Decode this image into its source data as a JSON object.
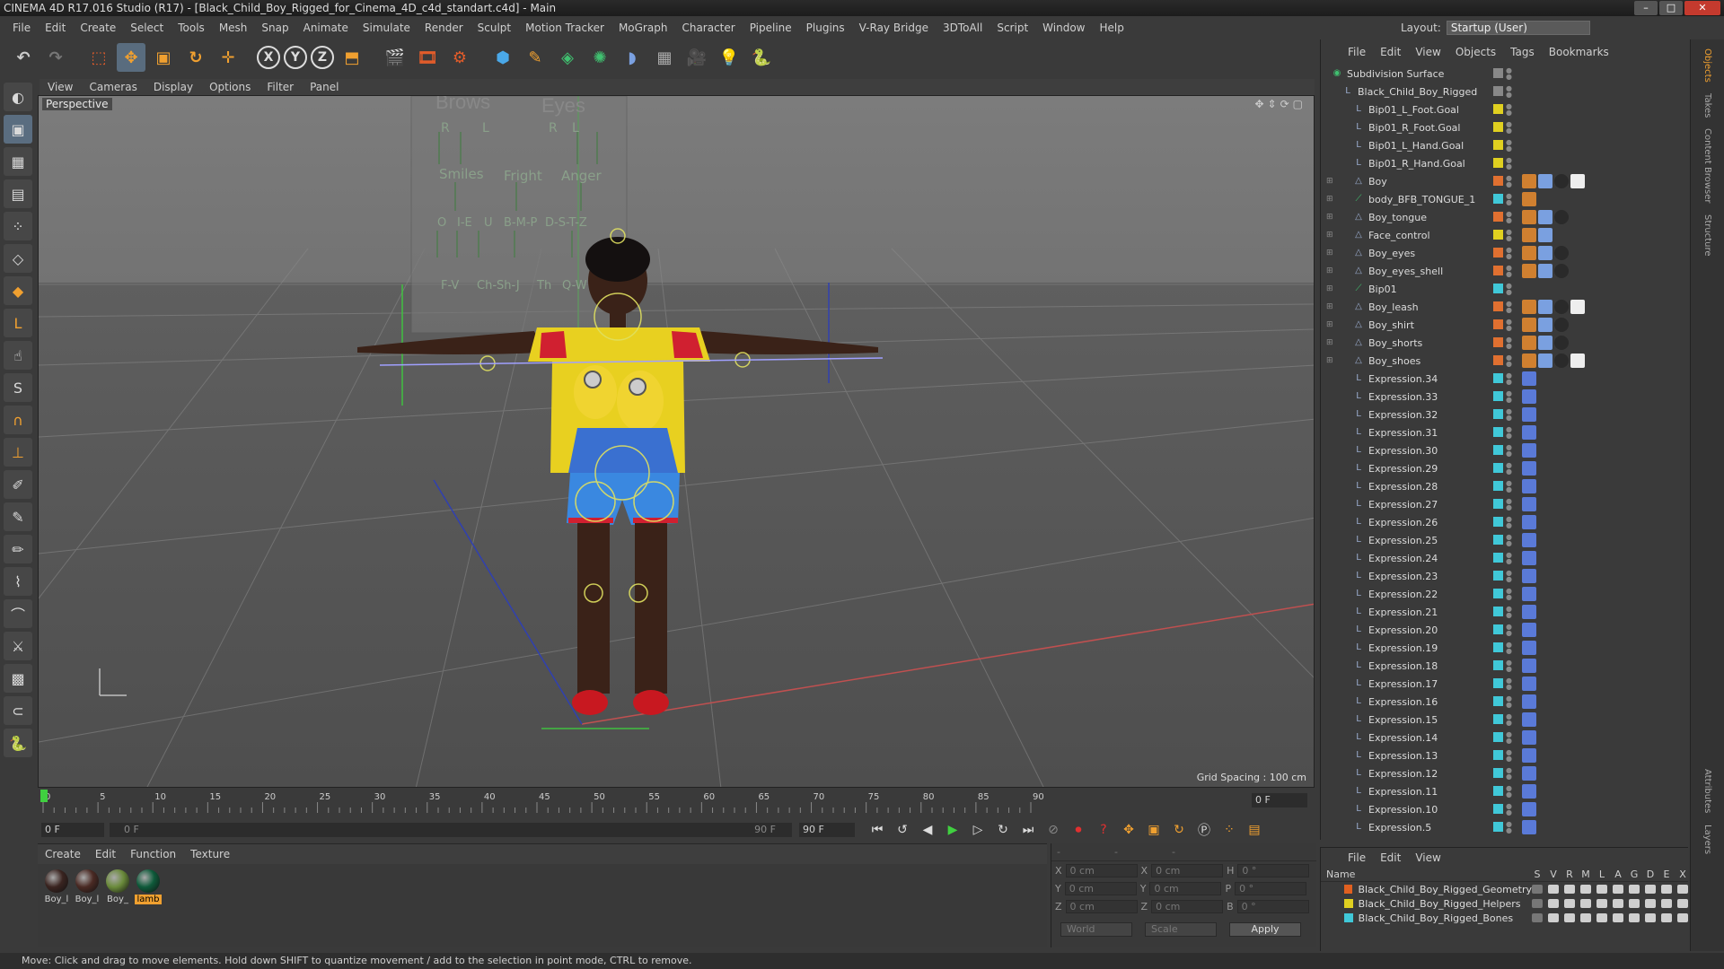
{
  "window": {
    "title": "CINEMA 4D R17.016 Studio (R17) - [Black_Child_Boy_Rigged_for_Cinema_4D_c4d_standart.c4d] - Main"
  },
  "menu": [
    "File",
    "Edit",
    "Create",
    "Select",
    "Tools",
    "Mesh",
    "Snap",
    "Animate",
    "Simulate",
    "Render",
    "Sculpt",
    "Motion Tracker",
    "MoGraph",
    "Character",
    "Pipeline",
    "Plugins",
    "V-Ray Bridge",
    "3DToAll",
    "Script",
    "Window",
    "Help"
  ],
  "layout": {
    "label": "Layout:",
    "value": "Startup (User)"
  },
  "viewport": {
    "menu": [
      "View",
      "Cameras",
      "Display",
      "Options",
      "Filter",
      "Panel"
    ],
    "label": "Perspective",
    "grid_spacing": "Grid Spacing : 100 cm",
    "face_panel": {
      "brows": "Brows",
      "eyes": "Eyes",
      "r1": "R",
      "l1": "L",
      "r2": "R",
      "l2": "L",
      "smiles": "Smiles",
      "fright": "Fright",
      "anger": "Anger",
      "o": "O",
      "ie": "I-E",
      "u": "U",
      "bmp": "B-M-P",
      "dstz": "D-S-T-Z",
      "fv": "F-V",
      "chshj": "Ch-Sh-J",
      "th": "Th",
      "qw": "Q-W"
    }
  },
  "timeline": {
    "ticks": [
      "0",
      "5",
      "10",
      "15",
      "20",
      "25",
      "30",
      "35",
      "40",
      "45",
      "50",
      "55",
      "60",
      "65",
      "70",
      "75",
      "80",
      "85",
      "90"
    ],
    "current_frame": "0 F",
    "start": "0 F",
    "range_start": "0 F",
    "range_end": "90 F",
    "end": "90 F"
  },
  "materials": {
    "menu": [
      "Create",
      "Edit",
      "Function",
      "Texture"
    ],
    "items": [
      {
        "label": "Boy_l",
        "color": "#3a2420"
      },
      {
        "label": "Boy_l",
        "color": "#4a2a24"
      },
      {
        "label": "Boy_",
        "color": "#6a8a3a"
      },
      {
        "label": "lamb",
        "color": "#0e5a3a"
      }
    ]
  },
  "coords": {
    "x1": "X",
    "x1v": "0 cm",
    "x2": "X",
    "x2v": "0 cm",
    "h": "H",
    "hv": "0 °",
    "y1": "Y",
    "y1v": "0 cm",
    "y2": "Y",
    "y2v": "0 cm",
    "p": "P",
    "pv": "0 °",
    "z1": "Z",
    "z1v": "0 cm",
    "z2": "Z",
    "z2v": "0 cm",
    "b": "B",
    "bv": "0 °",
    "world": "World",
    "scale": "Scale",
    "apply": "Apply"
  },
  "object_manager": {
    "menu": [
      "File",
      "Edit",
      "View",
      "Objects",
      "Tags",
      "Bookmarks"
    ],
    "objects": [
      {
        "name": "Subdivision Surface",
        "indent": 0,
        "color": "#888888"
      },
      {
        "name": "Black_Child_Boy_Rigged",
        "indent": 1,
        "color": "#888888"
      },
      {
        "name": "Bip01_L_Foot.Goal",
        "indent": 2,
        "color": "#e0d020"
      },
      {
        "name": "Bip01_R_Foot.Goal",
        "indent": 2,
        "color": "#e0d020"
      },
      {
        "name": "Bip01_L_Hand.Goal",
        "indent": 2,
        "color": "#e0d020"
      },
      {
        "name": "Bip01_R_Hand.Goal",
        "indent": 2,
        "color": "#e0d020"
      },
      {
        "name": "Boy",
        "indent": 2,
        "color": "#e07030"
      },
      {
        "name": "body_BFB_TONGUE_1",
        "indent": 2,
        "color": "#40c8d8"
      },
      {
        "name": "Boy_tongue",
        "indent": 2,
        "color": "#e07030"
      },
      {
        "name": "Face_control",
        "indent": 2,
        "color": "#e0d020"
      },
      {
        "name": "Boy_eyes",
        "indent": 2,
        "color": "#e07030"
      },
      {
        "name": "Boy_eyes_shell",
        "indent": 2,
        "color": "#e07030"
      },
      {
        "name": "Bip01",
        "indent": 2,
        "color": "#40c8d8"
      },
      {
        "name": "Boy_leash",
        "indent": 2,
        "color": "#e07030"
      },
      {
        "name": "Boy_shirt",
        "indent": 2,
        "color": "#e07030"
      },
      {
        "name": "Boy_shorts",
        "indent": 2,
        "color": "#e07030"
      },
      {
        "name": "Boy_shoes",
        "indent": 2,
        "color": "#e07030"
      },
      {
        "name": "Expression.34",
        "indent": 2,
        "color": "#40c8d8"
      },
      {
        "name": "Expression.33",
        "indent": 2,
        "color": "#40c8d8"
      },
      {
        "name": "Expression.32",
        "indent": 2,
        "color": "#40c8d8"
      },
      {
        "name": "Expression.31",
        "indent": 2,
        "color": "#40c8d8"
      },
      {
        "name": "Expression.30",
        "indent": 2,
        "color": "#40c8d8"
      },
      {
        "name": "Expression.29",
        "indent": 2,
        "color": "#40c8d8"
      },
      {
        "name": "Expression.28",
        "indent": 2,
        "color": "#40c8d8"
      },
      {
        "name": "Expression.27",
        "indent": 2,
        "color": "#40c8d8"
      },
      {
        "name": "Expression.26",
        "indent": 2,
        "color": "#40c8d8"
      },
      {
        "name": "Expression.25",
        "indent": 2,
        "color": "#40c8d8"
      },
      {
        "name": "Expression.24",
        "indent": 2,
        "color": "#40c8d8"
      },
      {
        "name": "Expression.23",
        "indent": 2,
        "color": "#40c8d8"
      },
      {
        "name": "Expression.22",
        "indent": 2,
        "color": "#40c8d8"
      },
      {
        "name": "Expression.21",
        "indent": 2,
        "color": "#40c8d8"
      },
      {
        "name": "Expression.20",
        "indent": 2,
        "color": "#40c8d8"
      },
      {
        "name": "Expression.19",
        "indent": 2,
        "color": "#40c8d8"
      },
      {
        "name": "Expression.18",
        "indent": 2,
        "color": "#40c8d8"
      },
      {
        "name": "Expression.17",
        "indent": 2,
        "color": "#40c8d8"
      },
      {
        "name": "Expression.16",
        "indent": 2,
        "color": "#40c8d8"
      },
      {
        "name": "Expression.15",
        "indent": 2,
        "color": "#40c8d8"
      },
      {
        "name": "Expression.14",
        "indent": 2,
        "color": "#40c8d8"
      },
      {
        "name": "Expression.13",
        "indent": 2,
        "color": "#40c8d8"
      },
      {
        "name": "Expression.12",
        "indent": 2,
        "color": "#40c8d8"
      },
      {
        "name": "Expression.11",
        "indent": 2,
        "color": "#40c8d8"
      },
      {
        "name": "Expression.10",
        "indent": 2,
        "color": "#40c8d8"
      },
      {
        "name": "Expression.5",
        "indent": 2,
        "color": "#40c8d8"
      }
    ]
  },
  "layer_manager": {
    "menu": [
      "File",
      "Edit",
      "View"
    ],
    "name_header": "Name",
    "cols": [
      "S",
      "V",
      "R",
      "M",
      "L",
      "A",
      "G",
      "D",
      "E",
      "X"
    ],
    "layers": [
      {
        "name": "Black_Child_Boy_Rigged_Geometry",
        "color": "#e06020"
      },
      {
        "name": "Black_Child_Boy_Rigged_Helpers",
        "color": "#e0d020"
      },
      {
        "name": "Black_Child_Boy_Rigged_Bones",
        "color": "#40c8d8"
      }
    ]
  },
  "right_tabs": [
    "Objects",
    "Takes",
    "Content Browser",
    "Structure",
    "Attributes",
    "Layers"
  ],
  "status": "Move: Click and drag to move elements. Hold down SHIFT to quantize movement / add to the selection in point mode, CTRL to remove."
}
